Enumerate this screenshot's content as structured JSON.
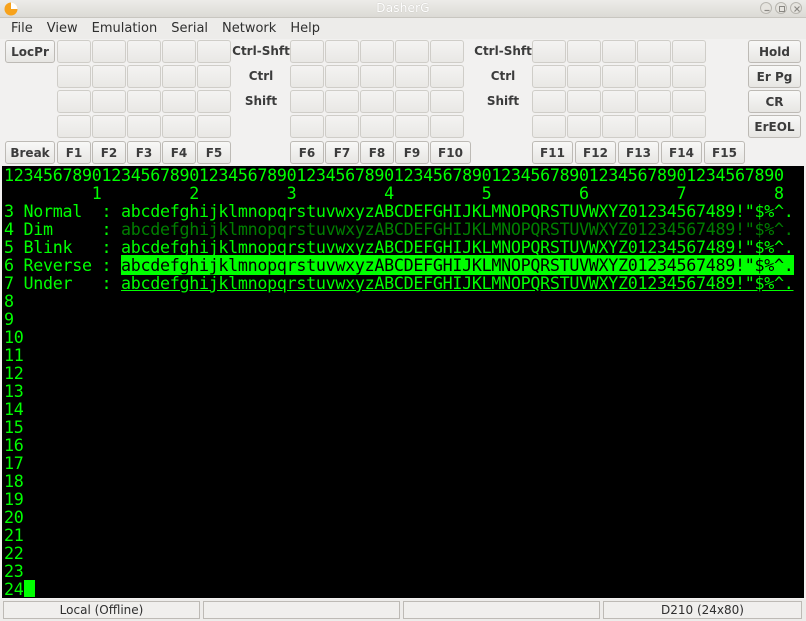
{
  "window": {
    "title": "DasherG"
  },
  "menu": [
    "File",
    "View",
    "Emulation",
    "Serial",
    "Network",
    "Help"
  ],
  "keys": {
    "locpr": "LocPr",
    "break": "Break",
    "hold": "Hold",
    "er_pg": "Er Pg",
    "cr": "CR",
    "ereol": "ErEOL",
    "row_labels": [
      "Ctrl-Shft",
      "Ctrl",
      "Shift"
    ],
    "fkeys": [
      "F1",
      "F2",
      "F3",
      "F4",
      "F5",
      "F6",
      "F7",
      "F8",
      "F9",
      "F10",
      "F11",
      "F12",
      "F13",
      "F14",
      "F15"
    ]
  },
  "terminal": {
    "ruler_digits": "12345678901234567890123456789012345678901234567890123456789012345678901234567890",
    "ruler_tens": "         1         2         3         4         5         6         7         8",
    "attr_lines": [
      {
        "prefix": "3 Normal  : ",
        "text": "abcdefghijklmnopqrstuvwxyzABCDEFGHIJKLMNOPQRSTUVWXYZ01234567489!\"$%^.",
        "attr": "normal"
      },
      {
        "prefix": "4 Dim     : ",
        "text": "abcdefghijklmnopqrstuvwxyzABCDEFGHIJKLMNOPQRSTUVWXYZ01234567489!\"$%^.",
        "attr": "dim"
      },
      {
        "prefix": "5 Blink   : ",
        "text": "abcdefghijklmnopqrstuvwxyzABCDEFGHIJKLMNOPQRSTUVWXYZ01234567489!\"$%^.",
        "attr": "normal"
      },
      {
        "prefix": "6 Reverse : ",
        "text": "abcdefghijklmnopqrstuvwxyzABCDEFGHIJKLMNOPQRSTUVWXYZ01234567489!\"$%^.",
        "attr": "rev"
      },
      {
        "prefix": "7 Under   : ",
        "text": "abcdefghijklmnopqrstuvwxyzABCDEFGHIJKLMNOPQRSTUVWXYZ01234567489!\"$%^.",
        "attr": "und"
      }
    ],
    "line_numbers": [
      "8",
      "9",
      "10",
      "11",
      "12",
      "13",
      "14",
      "15",
      "16",
      "17",
      "18",
      "19",
      "20",
      "21",
      "22",
      "23",
      "24"
    ],
    "colors": {
      "fg": "#00ff00",
      "dim": "#007f00",
      "bg": "#000000"
    }
  },
  "status": {
    "connection": "Local (Offline)",
    "panel2": "",
    "panel3": "",
    "emulation": "D210 (24x80)"
  }
}
